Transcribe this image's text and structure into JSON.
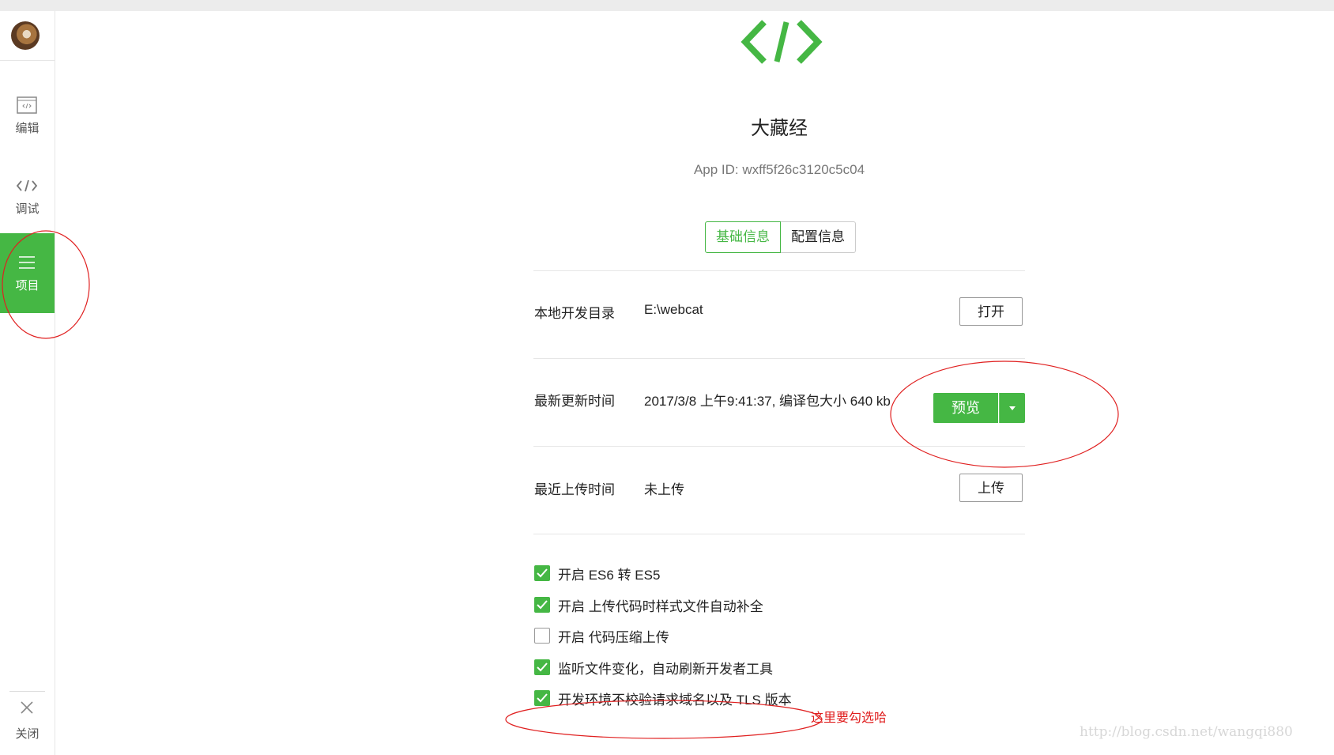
{
  "sidebar": {
    "items": [
      {
        "label": "编辑",
        "icon": "editor-icon"
      },
      {
        "label": "调试",
        "icon": "code-icon"
      },
      {
        "label": "项目",
        "icon": "menu-icon",
        "active": true
      }
    ],
    "close_label": "关闭"
  },
  "app": {
    "logo_icon": "code-brackets-icon",
    "name": "大藏经",
    "app_id": "App ID: wxff5f26c3120c5c04"
  },
  "tabs": [
    {
      "label": "基础信息",
      "active": true
    },
    {
      "label": "配置信息",
      "active": false
    }
  ],
  "rows": {
    "local_dir": {
      "label": "本地开发目录",
      "value": "E:\\webcat",
      "button": "打开"
    },
    "last_update": {
      "label": "最新更新时间",
      "value": "2017/3/8 上午9:41:37, 编译包大小 640 kb",
      "button": "预览"
    },
    "last_upload": {
      "label": "最近上传时间",
      "value": "未上传",
      "button": "上传"
    }
  },
  "options": [
    {
      "label": "开启 ES6 转 ES5",
      "checked": true
    },
    {
      "label": "开启 上传代码时样式文件自动补全",
      "checked": true
    },
    {
      "label": "开启 代码压缩上传",
      "checked": false
    },
    {
      "label": "监听文件变化，自动刷新开发者工具",
      "checked": true
    },
    {
      "label": "开发环境不校验请求域名以及 TLS 版本",
      "checked": true
    }
  ],
  "annotation_note": "这里要勾选哈",
  "watermark": "http://blog.csdn.net/wangqi880",
  "colors": {
    "accent": "#45b744",
    "annotation": "#e02020"
  }
}
